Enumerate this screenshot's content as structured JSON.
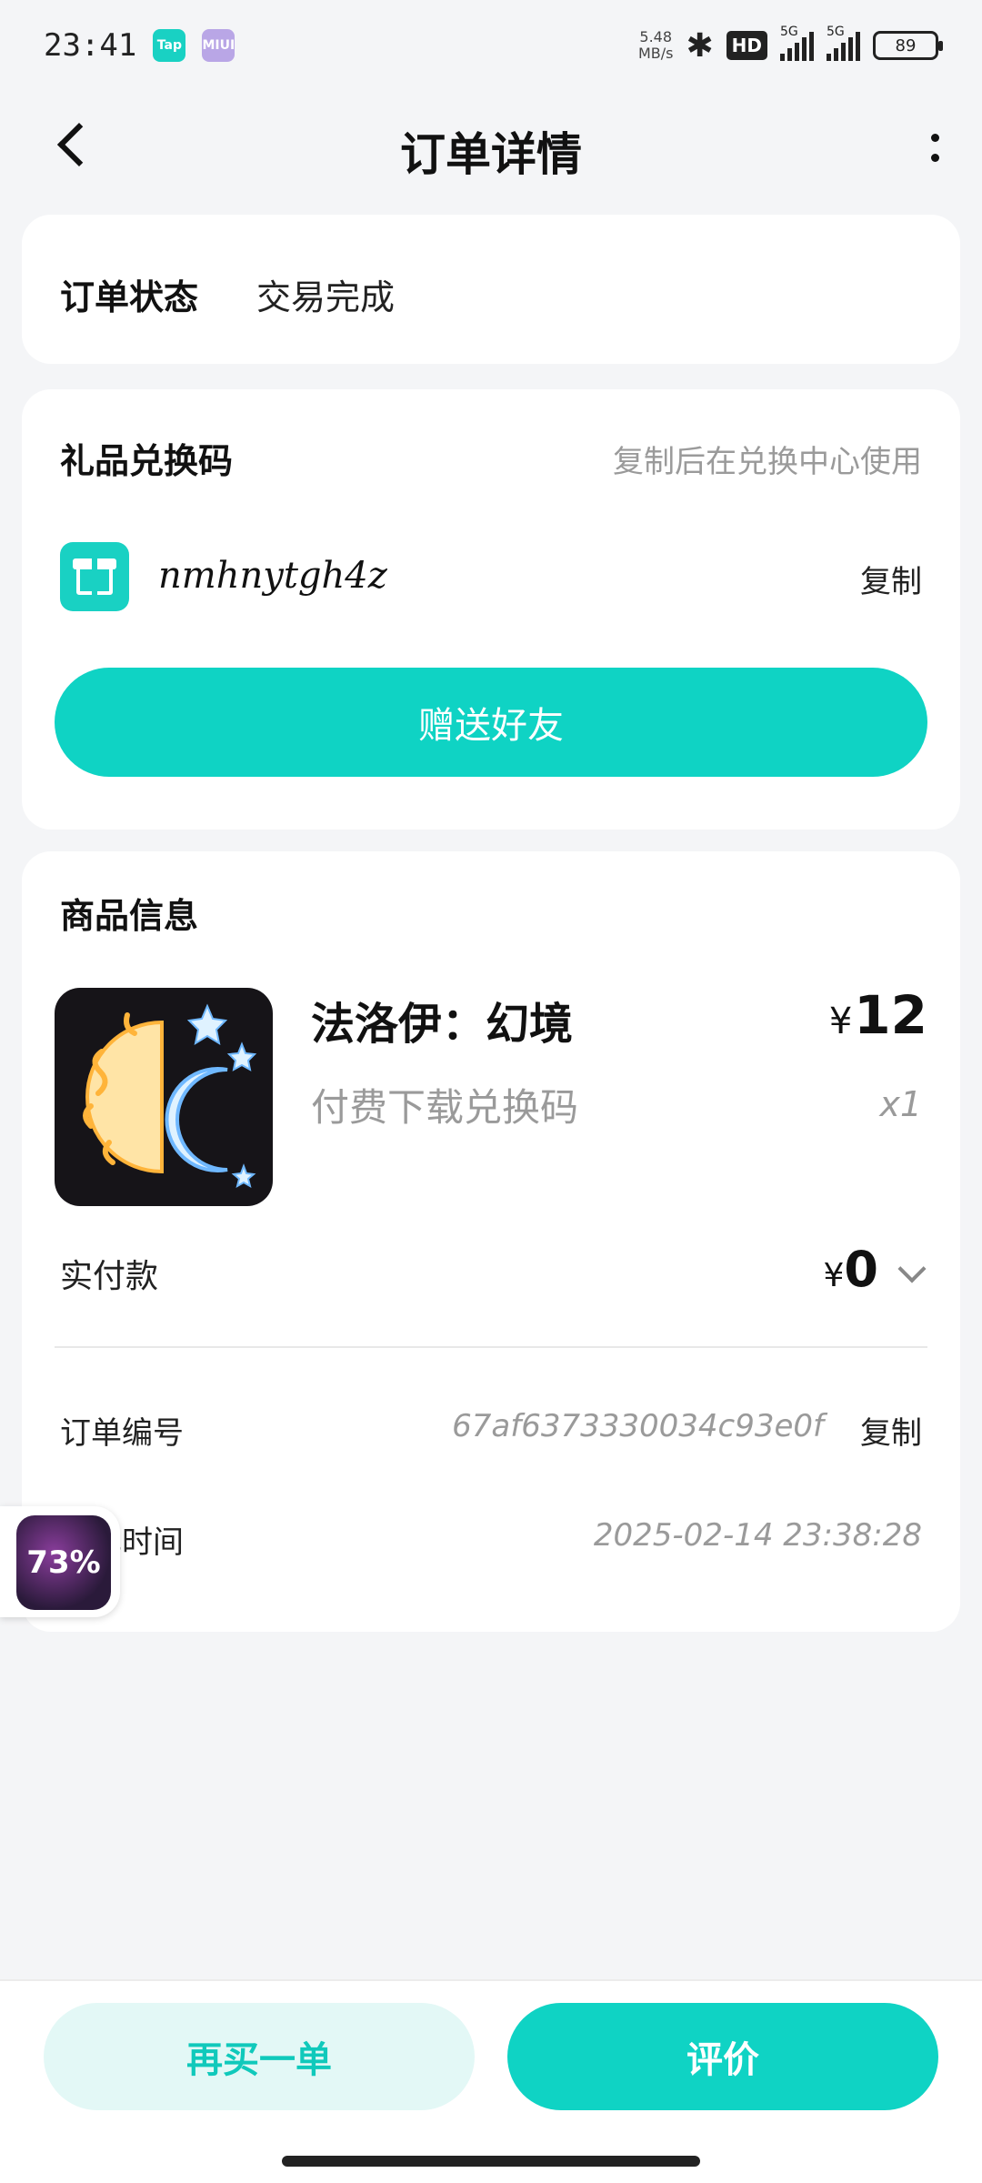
{
  "status_bar": {
    "time": "23:41",
    "apps": [
      "Tap",
      "MIUI"
    ],
    "net_speed": "5.48",
    "net_unit": "MB/s",
    "hd": "HD",
    "signal_labels": [
      "5G",
      "5G"
    ],
    "battery": "89"
  },
  "header": {
    "title": "订单详情"
  },
  "order_status": {
    "label": "订单状态",
    "value": "交易完成"
  },
  "gift": {
    "title": "礼品兑换码",
    "hint": "复制后在兑换中心使用",
    "code": "nmhnytgh4z",
    "copy_label": "复制",
    "send_button": "赠送好友",
    "accent": "#0fd3c4"
  },
  "product": {
    "section_title": "商品信息",
    "name": "法洛伊：幻境",
    "description": "付费下载兑换码",
    "currency": "¥",
    "price": "12",
    "quantity": "x1"
  },
  "payment": {
    "label": "实付款",
    "currency": "¥",
    "value": "0"
  },
  "order": {
    "number_label": "订单编号",
    "number": "67af6373330034c93e0f",
    "copy_label": "复制",
    "time_label": "下单时间",
    "time": "2025-02-14  23:38:28"
  },
  "floating": {
    "progress": "73%"
  },
  "actions": {
    "rebuy": "再买一单",
    "review": "评价"
  }
}
